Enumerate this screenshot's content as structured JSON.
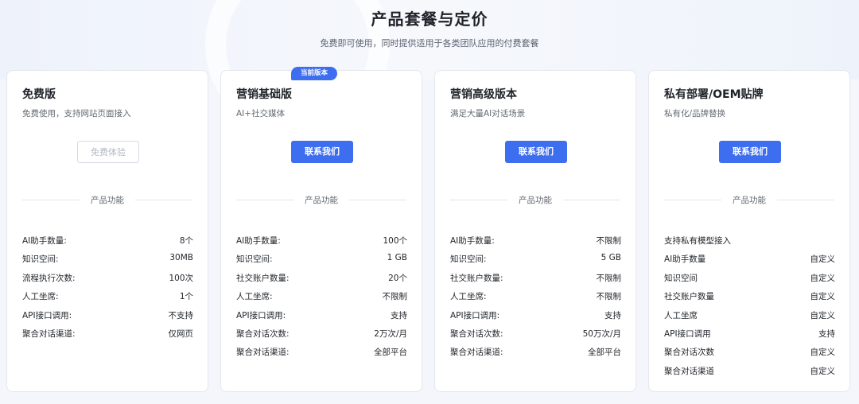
{
  "header": {
    "title": "产品套餐与定价",
    "subtitle": "免费即可使用，同时提供适用于各类团队应用的付费套餐"
  },
  "accent_color": "#3d6ef0",
  "plans": [
    {
      "name": "免费版",
      "desc": "免费使用，支持网站页面接入",
      "button": "免费体验",
      "divider": "产品功能",
      "features": [
        {
          "label": "AI助手数量:",
          "value": "8个"
        },
        {
          "label": "知识空间:",
          "value": "30MB"
        },
        {
          "label": "流程执行次数:",
          "value": "100次"
        },
        {
          "label": "人工坐席:",
          "value": "1个"
        },
        {
          "label": "API接口调用:",
          "value": "不支持"
        },
        {
          "label": "聚合对话渠道:",
          "value": "仅网页"
        }
      ]
    },
    {
      "name": "营销基础版",
      "badge": "当前版本",
      "desc": "AI+社交媒体",
      "button": "联系我们",
      "divider": "产品功能",
      "features": [
        {
          "label": "AI助手数量:",
          "value": "100个"
        },
        {
          "label": "知识空间:",
          "value": "1 GB"
        },
        {
          "label": "社交账户数量:",
          "value": "20个"
        },
        {
          "label": "人工坐席:",
          "value": "不限制"
        },
        {
          "label": "API接口调用:",
          "value": "支持"
        },
        {
          "label": "聚合对话次数:",
          "value": "2万次/月"
        },
        {
          "label": "聚合对话渠道:",
          "value": "全部平台"
        }
      ]
    },
    {
      "name": "营销高级版本",
      "desc": "满足大量AI对话场景",
      "button": "联系我们",
      "divider": "产品功能",
      "features": [
        {
          "label": "AI助手数量:",
          "value": "不限制"
        },
        {
          "label": "知识空间:",
          "value": "5 GB"
        },
        {
          "label": "社交账户数量:",
          "value": "不限制"
        },
        {
          "label": "人工坐席:",
          "value": "不限制"
        },
        {
          "label": "API接口调用:",
          "value": "支持"
        },
        {
          "label": "聚合对话次数:",
          "value": "50万次/月"
        },
        {
          "label": "聚合对话渠道:",
          "value": "全部平台"
        }
      ]
    },
    {
      "name": "私有部署/OEM贴牌",
      "desc": "私有化/品牌替换",
      "button": "联系我们",
      "divider": "产品功能",
      "features": [
        {
          "label": "支持私有模型接入",
          "value": ""
        },
        {
          "label": "AI助手数量",
          "value": "自定义"
        },
        {
          "label": "知识空间",
          "value": "自定义"
        },
        {
          "label": "社交账户数量",
          "value": "自定义"
        },
        {
          "label": "人工坐席",
          "value": "自定义"
        },
        {
          "label": "API接口调用",
          "value": "支持"
        },
        {
          "label": "聚合对话次数",
          "value": "自定义"
        },
        {
          "label": "聚合对话渠道",
          "value": "自定义"
        }
      ]
    }
  ]
}
